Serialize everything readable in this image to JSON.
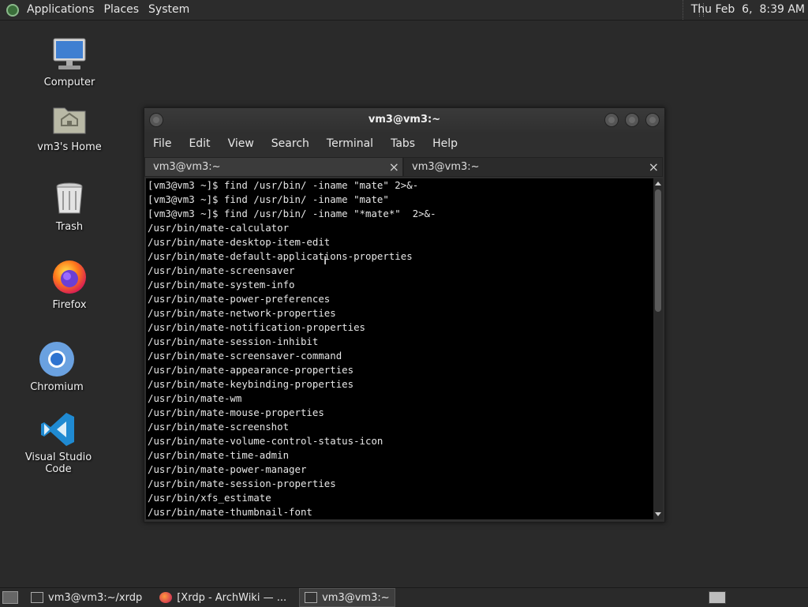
{
  "top_panel": {
    "menu": [
      "Applications",
      "Places",
      "System"
    ],
    "clock": "Thu Feb  6,  8:39 AM"
  },
  "desktop_icons": [
    {
      "label": "Computer",
      "icon": "computer-icon"
    },
    {
      "label": "vm3's Home",
      "icon": "home-folder-icon"
    },
    {
      "label": "Trash",
      "icon": "trash-icon"
    },
    {
      "label": "Firefox",
      "icon": "firefox-icon"
    },
    {
      "label": "Chromium",
      "icon": "chromium-icon"
    },
    {
      "label": "Visual Studio Code",
      "icon": "vscode-icon"
    }
  ],
  "terminal": {
    "title": "vm3@vm3:~",
    "menu": [
      "File",
      "Edit",
      "View",
      "Search",
      "Terminal",
      "Tabs",
      "Help"
    ],
    "tabs": [
      {
        "label": "vm3@vm3:~",
        "close": "×"
      },
      {
        "label": "vm3@vm3:~",
        "close": "×"
      }
    ],
    "lines": [
      "[vm3@vm3 ~]$ find /usr/bin/ -iname \"mate\" 2>&-",
      "[vm3@vm3 ~]$ find /usr/bin/ -iname \"mate\"",
      "[vm3@vm3 ~]$ find /usr/bin/ -iname \"*mate*\"  2>&-",
      "/usr/bin/mate-calculator",
      "/usr/bin/mate-desktop-item-edit",
      "/usr/bin/mate-default-applications-properties",
      "/usr/bin/mate-screensaver",
      "/usr/bin/mate-system-info",
      "/usr/bin/mate-power-preferences",
      "/usr/bin/mate-network-properties",
      "/usr/bin/mate-notification-properties",
      "/usr/bin/mate-session-inhibit",
      "/usr/bin/mate-screensaver-command",
      "/usr/bin/mate-appearance-properties",
      "/usr/bin/mate-keybinding-properties",
      "/usr/bin/mate-wm",
      "/usr/bin/mate-mouse-properties",
      "/usr/bin/mate-screenshot",
      "/usr/bin/mate-volume-control-status-icon",
      "/usr/bin/mate-time-admin",
      "/usr/bin/mate-power-manager",
      "/usr/bin/mate-session-properties",
      "/usr/bin/xfs_estimate",
      "/usr/bin/mate-thumbnail-font"
    ]
  },
  "taskbar": {
    "tasks": [
      {
        "label": "vm3@vm3:~/xrdp",
        "icon": "terminal-icon",
        "active": false
      },
      {
        "label": "[Xrdp - ArchWiki — ...",
        "icon": "firefox-icon",
        "active": false
      },
      {
        "label": "vm3@vm3:~",
        "icon": "terminal-icon",
        "active": true
      }
    ]
  }
}
